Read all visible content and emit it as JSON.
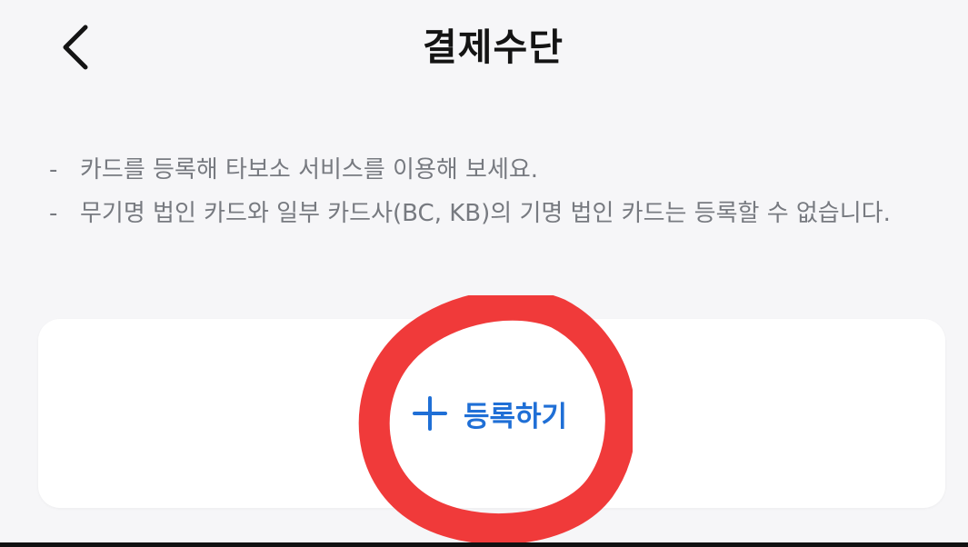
{
  "header": {
    "title": "결제수단",
    "back_icon": "chevron-left-icon"
  },
  "notices": [
    "카드를 등록해 타보소 서비스를 이용해 보세요.",
    "무기명 법인 카드와 일부 카드사(BC, KB)의 기명 법인 카드는 등록할 수 없습니다."
  ],
  "notice_prefix": "-",
  "card": {
    "register_label": "등록하기",
    "register_icon": "plus-icon"
  },
  "colors": {
    "accent": "#1f6fd6",
    "annotation": "#f03a3a",
    "background": "#f6f6f8"
  }
}
